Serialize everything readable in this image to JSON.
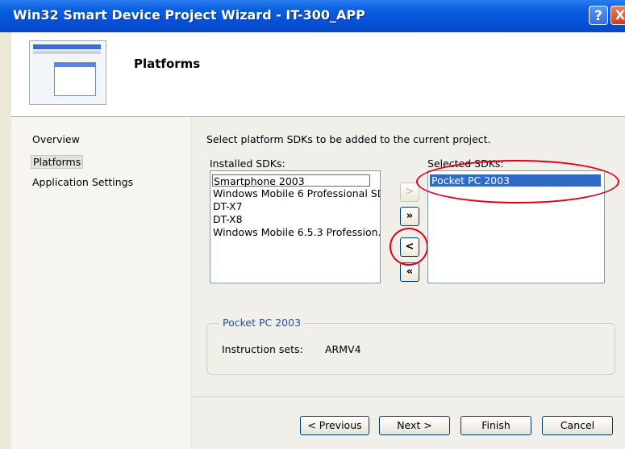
{
  "window": {
    "title": "Win32 Smart Device Project Wizard - IT-300_APP",
    "help_label": "?",
    "close_label": "X"
  },
  "header": {
    "title": "Platforms"
  },
  "nav": {
    "items": [
      {
        "label": "Overview"
      },
      {
        "label": "Platforms"
      },
      {
        "label": "Application Settings"
      }
    ]
  },
  "main": {
    "intro": "Select platform SDKs to be added to the current project.",
    "installed_label": "Installed SDKs:",
    "installed_items": [
      "Smartphone 2003",
      "Windows Mobile 6 Professional SD",
      "DT-X7",
      "DT-X8",
      "Windows Mobile 6.5.3 Profession."
    ],
    "selected_label": "Selected SDKs:",
    "selected_items": [
      "Pocket PC 2003"
    ],
    "move_buttons": {
      "add_one": ">",
      "add_all": "»",
      "remove_one": "<",
      "remove_all": "«"
    },
    "group": {
      "title": "Pocket PC 2003",
      "instruction_label": "Instruction sets:",
      "instruction_value": "ARMV4"
    }
  },
  "footer": {
    "previous": "< Previous",
    "next": "Next >",
    "finish": "Finish",
    "cancel": "Cancel"
  },
  "colors": {
    "titlebar": "#0550d8",
    "selection": "#316ac5",
    "annotation_ring": "#e0001a",
    "group_title": "#1f4fa8"
  }
}
